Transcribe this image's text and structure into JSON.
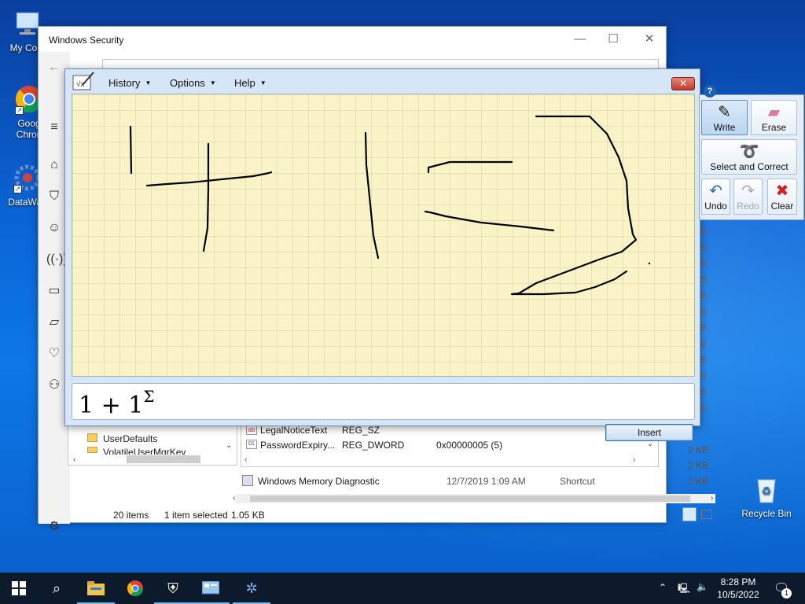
{
  "desktop": {
    "icons": [
      {
        "label": "My Com",
        "icon": "computer-icon"
      },
      {
        "label": "Goog\nChron",
        "icon": "chrome-icon"
      },
      {
        "label": "DataWag",
        "icon": "datawag-icon"
      },
      {
        "label": "Recycle Bin",
        "icon": "recycle-bin-icon"
      }
    ]
  },
  "security_window": {
    "title": "Windows Security",
    "minimize": "—",
    "maximize": "☐",
    "close": "✕",
    "sidebar_icons": [
      "back-icon",
      "menu-icon",
      "home-icon",
      "shield-icon",
      "person-icon",
      "wifi-icon",
      "browser-icon",
      "laptop-icon",
      "heart-icon",
      "family-icon",
      "settings-icon"
    ]
  },
  "explorer": {
    "tree_items": [
      "UserDefaults",
      "VolatileUserMgrKey"
    ],
    "reg_rows": [
      {
        "name": "LegalNoticeText",
        "type": "REG_SZ",
        "data": ""
      },
      {
        "name": "PasswordExpiry...",
        "type": "REG_DWORD",
        "data": "0x00000005 (5)"
      }
    ],
    "file_row": {
      "name": "Windows Memory Diagnostic",
      "date": "12/7/2019 1:09 AM",
      "type": "Shortcut",
      "size": "2 KB"
    },
    "sizes": [
      "2 KB",
      "2 KB"
    ],
    "status": {
      "items": "20 items",
      "selected": "1 item selected",
      "size": "1.05 KB"
    }
  },
  "math_panel": {
    "menus": [
      "History",
      "Options",
      "Help"
    ],
    "close": "✕",
    "preview": "1 + 1",
    "preview_sup": "Σ",
    "insert_label": "Insert",
    "tools": {
      "write": "Write",
      "erase": "Erase",
      "select_correct": "Select and Correct",
      "undo": "Undo",
      "redo": "Redo",
      "clear": "Clear"
    },
    "ink_color": "#000000",
    "canvas_color": "#fbf3c8"
  },
  "taskbar": {
    "apps": [
      "start-icon",
      "search-icon",
      "file-explorer-icon",
      "chrome-icon",
      "windows-security-icon",
      "control-panel-icon",
      "datawag-icon"
    ],
    "time": "8:28 PM",
    "date": "10/5/2022",
    "notification_count": "1"
  }
}
